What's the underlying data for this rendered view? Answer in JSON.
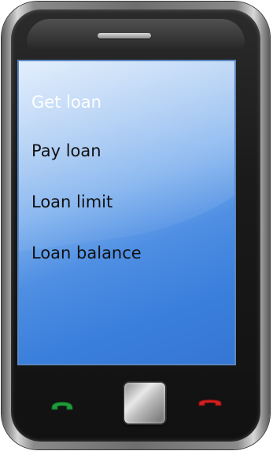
{
  "menu": {
    "items": [
      {
        "label": "Get loan",
        "selected": true
      },
      {
        "label": "Pay loan",
        "selected": false
      },
      {
        "label": "Loan limit",
        "selected": false
      },
      {
        "label": "Loan balance",
        "selected": false
      }
    ]
  },
  "icons": {
    "call": "phone-call-icon",
    "end_call": "phone-end-icon",
    "home": "home-button"
  },
  "colors": {
    "selected_text": "#ffffff",
    "menu_text": "#111111",
    "call_green": "#1e9b3a",
    "end_red": "#d02020"
  }
}
